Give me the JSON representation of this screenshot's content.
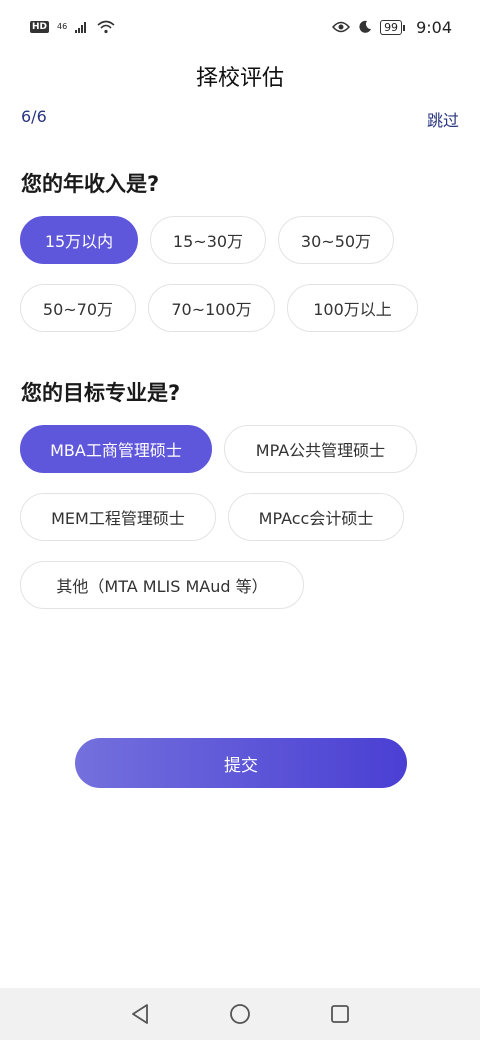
{
  "status_bar": {
    "hd": "HD",
    "network": "46",
    "battery": "99",
    "time": "9:04"
  },
  "header": {
    "title": "择校评估",
    "progress": "6/6",
    "skip_label": "跳过"
  },
  "income": {
    "question": "您的年收入是?",
    "options_row1": [
      "15万以内",
      "15~30万",
      "30~50万"
    ],
    "options_row2": [
      "50~70万",
      "70~100万",
      "100万以上"
    ],
    "selected": "15万以内"
  },
  "major": {
    "question": "您的目标专业是?",
    "options_row1": [
      "MBA工商管理硕士",
      "MPA公共管理硕士"
    ],
    "options_row2": [
      "MEM工程管理硕士",
      "MPAcc会计硕士"
    ],
    "options_row3": [
      "其他（MTA MLIS MAud 等）"
    ],
    "selected": "MBA工商管理硕士"
  },
  "submit_label": "提交",
  "colors": {
    "accent": "#5e56db",
    "link": "#2a3580"
  }
}
